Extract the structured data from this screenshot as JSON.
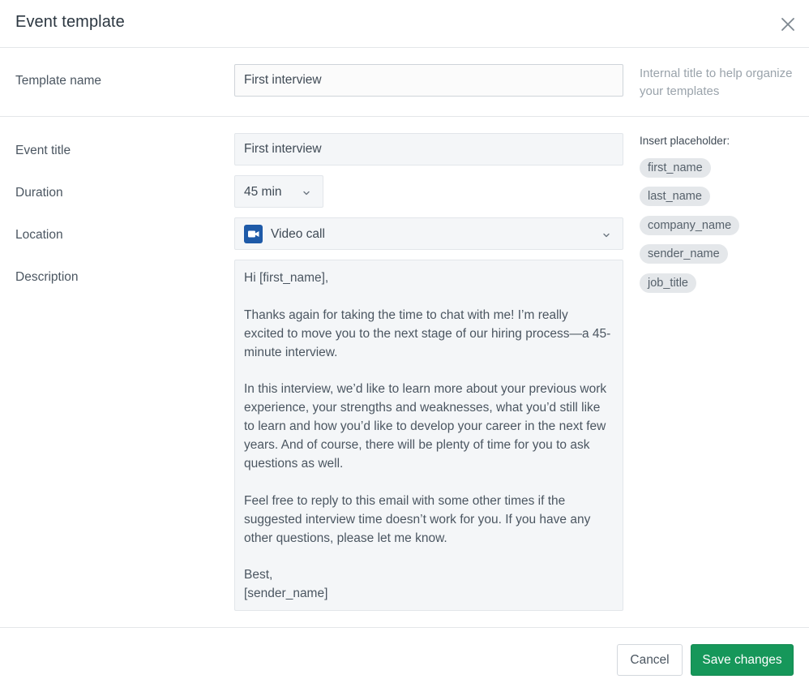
{
  "dialog": {
    "title": "Event template",
    "close_icon": "close-icon"
  },
  "template_name": {
    "label": "Template name",
    "value": "First interview",
    "help_text": "Internal title to help organize your templates"
  },
  "event_title": {
    "label": "Event title",
    "value": "First interview"
  },
  "duration": {
    "label": "Duration",
    "value": "45 min",
    "icon": "chevron-down-icon"
  },
  "location": {
    "label": "Location",
    "value": "Video call",
    "icon": "video-camera-icon",
    "icon_color": "#1e5aa8"
  },
  "description": {
    "label": "Description",
    "paragraphs": [
      "Hi [first_name],",
      "Thanks again for taking the time to chat with me! I’m really excited to move you to the next stage of our hiring process—a 45-minute interview.",
      "In this interview, we’d like to learn more about your previous work experience, your strengths and weaknesses, what you’d still like to learn and how you’d like to develop your career in the next few years. And of course, there will be plenty of time for you to ask questions as well.",
      "Feel free to reply to this email with some other times if the suggested interview time doesn’t work for you. If you have any other questions, please let me know."
    ],
    "signoff": "Best,",
    "signature": "[sender_name]"
  },
  "placeholders": {
    "title": "Insert placeholder:",
    "items": [
      "first_name",
      "last_name",
      "company_name",
      "sender_name",
      "job_title"
    ]
  },
  "footer": {
    "cancel_label": "Cancel",
    "save_label": "Save changes",
    "save_color": "#16975a"
  }
}
